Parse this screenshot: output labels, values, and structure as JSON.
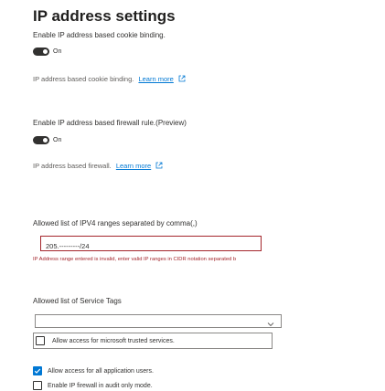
{
  "title": "IP address settings",
  "cookie_binding": {
    "label": "Enable IP address based cookie binding.",
    "toggle_text": "On",
    "desc": "IP address based cookie binding.",
    "link": "Learn more"
  },
  "firewall": {
    "label": "Enable IP address based firewall rule.(Preview)",
    "toggle_text": "On",
    "desc": "IP address based firewall.",
    "link": "Learn more"
  },
  "ipv4": {
    "label": "Allowed list of IPV4 ranges separated by comma(,)",
    "value": "205.---------/24",
    "error": "IP Address range entered is invalid, enter valid IP ranges in CIDR notation separated b"
  },
  "service_tags": {
    "label": "Allowed list of Service Tags",
    "options": [
      {
        "label": "Allow access for microsoft trusted services.",
        "checked": false
      }
    ]
  },
  "checkboxes": {
    "allow_app_users": {
      "label": "Allow access for all application users.",
      "checked": true
    },
    "audit_mode": {
      "label": "Enable IP firewall in audit only mode.",
      "checked": false
    }
  },
  "colors": {
    "accent": "#0078d4",
    "error": "#a4262c",
    "toggle_on": "#323130"
  }
}
